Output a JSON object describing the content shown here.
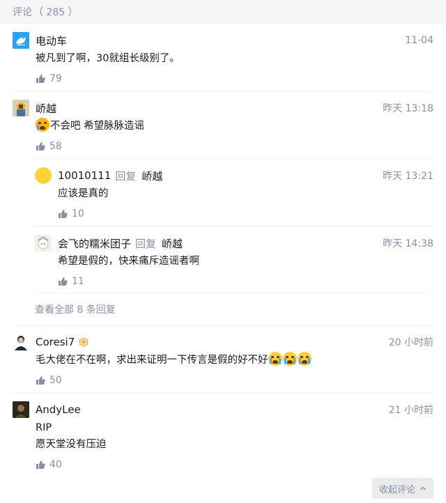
{
  "header": {
    "title": "评论",
    "count": "（ 285 ）"
  },
  "comments": [
    {
      "author": "电动车",
      "time": "11-04",
      "content": "被凡到了啊，30就组长级别了。",
      "likes": "79"
    },
    {
      "author": "峤越",
      "time": "昨天 13:18",
      "content": "不会吧 希望脉脉造谣",
      "likes": "58",
      "replies": [
        {
          "author": "10010111",
          "reply_word": "回复",
          "reply_to": "峤越",
          "time": "昨天 13:21",
          "content": "应该是真的",
          "likes": "10"
        },
        {
          "author": "会飞的糯米团子",
          "reply_word": "回复",
          "reply_to": "峤越",
          "time": "昨天 14:38",
          "content": "希望是假的，快来痛斥造谣者啊",
          "likes": "11"
        }
      ],
      "view_all": "查看全部 8 条回复"
    },
    {
      "author": "Coresi7",
      "time": "20 小时前",
      "content": "毛大佬在不在啊，求出来证明一下传言是假的好不好",
      "likes": "50"
    },
    {
      "author": "AndyLee",
      "time": "21 小时前",
      "content_line1": "RIP",
      "content_line2": "愿天堂没有压迫",
      "likes": "40"
    }
  ],
  "collapse_label": "收起评论",
  "colors": {
    "meta": "#8590a6",
    "text": "#1a1a1a",
    "accent": "#0084ff"
  },
  "icons": [
    "thumbs-up-icon",
    "chevron-up-icon",
    "badge-icon",
    "sad-emoji-icon",
    "crying-emoji-icon"
  ]
}
